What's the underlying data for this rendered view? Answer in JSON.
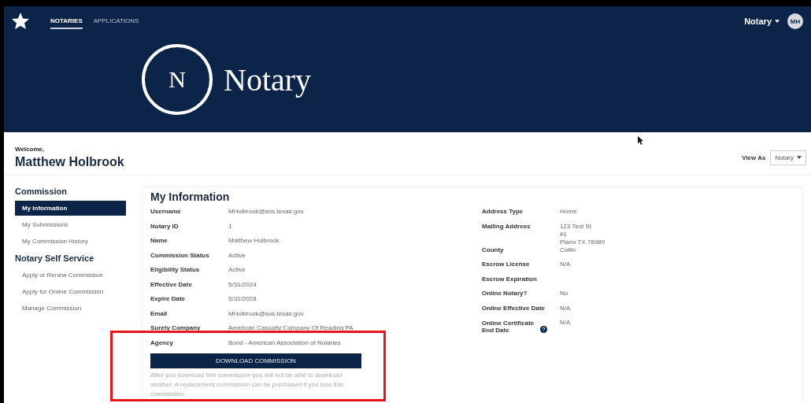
{
  "nav": {
    "tabs": [
      {
        "label": "NOTARIES",
        "selected": true
      },
      {
        "label": "APPLICATIONS",
        "selected": false
      }
    ],
    "user_menu": "Notary",
    "avatar": "MH"
  },
  "banner": {
    "logo_letter": "N",
    "title": "Notary"
  },
  "welcome": {
    "greeting": "Welcome,",
    "name": "Matthew Holbrook"
  },
  "view_as": {
    "label": "View As",
    "value": "Notary"
  },
  "sidebar": [
    {
      "title": "Commission",
      "items": [
        {
          "label": "My Information",
          "selected": true
        },
        {
          "label": "My Submissions",
          "selected": false
        },
        {
          "label": "My Commission History",
          "selected": false
        }
      ]
    },
    {
      "title": "Notary Self Service",
      "items": [
        {
          "label": "Apply or Renew Commission",
          "selected": false
        },
        {
          "label": "Apply for Online Commission",
          "selected": false
        },
        {
          "label": "Manage Commission",
          "selected": false
        }
      ]
    }
  ],
  "info": {
    "title": "My Information",
    "left": [
      {
        "label": "Username",
        "value": [
          "MHolbrook@sos.texas.gov"
        ]
      },
      {
        "label": "Notary ID",
        "value": [
          "1"
        ]
      },
      {
        "label": "Name",
        "value": [
          "Matthew Holbrook"
        ]
      },
      {
        "label": "Commission Status",
        "value": [
          "Active"
        ]
      },
      {
        "label": "Eligibility Status",
        "value": [
          "Active"
        ]
      },
      {
        "label": "Effective Date",
        "value": [
          "5/31/2024"
        ]
      },
      {
        "label": "Expire Date",
        "value": [
          "5/31/2028"
        ]
      },
      {
        "label": "Email",
        "value": [
          "MHolbrook@sos.texas.gov"
        ]
      },
      {
        "label": "Surety Company",
        "value": [
          "American Casualty Company Of Reading PA"
        ]
      },
      {
        "label": "Agency",
        "value": [
          "Bond - American Association of Notaries"
        ]
      }
    ],
    "right": [
      {
        "label": "Address Type",
        "value": [
          "Home"
        ]
      },
      {
        "label": "Mailing Address",
        "value": [
          "123 Test St",
          "#1",
          "Plano TX 78989"
        ]
      },
      {
        "label": "County",
        "value": [
          "Collin"
        ]
      },
      {
        "label": "Escrow License",
        "value": [
          "N/A"
        ]
      },
      {
        "label": "Escrow Expiration"
      },
      {
        "label": "Online Notary?",
        "value": [
          "No"
        ]
      },
      {
        "label": "Online Effective Date",
        "value": [
          "N/A"
        ]
      },
      {
        "label": "Online Certificate End Date",
        "value": [
          "N/A"
        ],
        "help": true
      }
    ],
    "button": "DOWNLOAD COMMISSION",
    "note": "After you download this commission you will not be able to download another. A replacement commission can be purchased if you lose this commission."
  },
  "annotation": {
    "highlight": true
  }
}
